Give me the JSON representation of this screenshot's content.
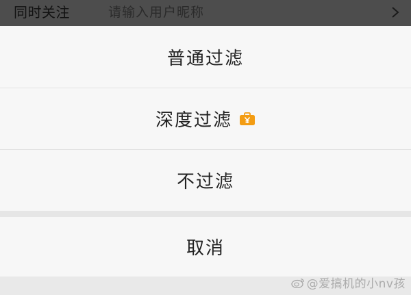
{
  "topbar": {
    "label": "同时关注",
    "input_placeholder": "请输入用户昵称",
    "chevron_icon": "chevron-right-icon"
  },
  "action_sheet": {
    "options": [
      {
        "label": "普通过滤"
      },
      {
        "label": "深度过滤",
        "badge_icon": "vip-briefcase-icon",
        "badge_color": "#f39c12"
      },
      {
        "label": "不过滤"
      }
    ],
    "cancel_label": "取消"
  },
  "watermark": {
    "text": "@爱搞机的小nv孩",
    "icon": "weibo-logo-icon"
  },
  "colors": {
    "overlay_bar": "#4d4d4d",
    "sheet_background": "#f7f7f7",
    "separator": "#e1e1e1",
    "vip_orange": "#f39c12"
  }
}
